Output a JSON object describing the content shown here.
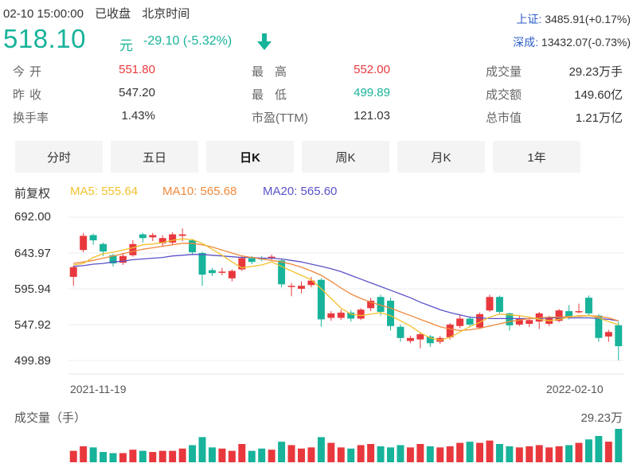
{
  "header": {
    "date_time": "02-10 15:00:00",
    "status": "已收盘",
    "timezone": "北京时间",
    "price": "518.10",
    "currency": "元",
    "change": "-29.10 (-5.32%)",
    "index_sh_label": "上证:",
    "index_sh_value": "3485.91(+0.17%)",
    "index_sz_label": "深成:",
    "index_sz_value": "13432.07(-0.73%)"
  },
  "quote": {
    "open_label": "今开",
    "open": "551.80",
    "prev_label": "昨收",
    "prev": "547.20",
    "turnover_rate_label": "换手率",
    "turnover_rate": "1.43%",
    "high_label": "最高",
    "high": "552.00",
    "low_label": "最低",
    "low": "499.89",
    "pe_label": "市盈(TTM)",
    "pe": "121.03",
    "volume_label": "成交量",
    "volume": "29.23万手",
    "amount_label": "成交额",
    "amount": "149.60亿",
    "mktcap_label": "总市值",
    "mktcap": "1.21万亿"
  },
  "tabs": [
    "分时",
    "五日",
    "日K",
    "周K",
    "月K",
    "1年"
  ],
  "active_tab": 2,
  "indicators": {
    "adjust": "前复权",
    "ma5": "MA5: 555.64",
    "ma10": "MA10: 565.68",
    "ma20": "MA20: 565.60"
  },
  "colors": {
    "up": "#e8383d",
    "down": "#17b39a",
    "ma5": "#f2c12e",
    "ma10": "#f08a3c",
    "ma20": "#5b52c7",
    "index_label": "#2b5cc8"
  },
  "chart_data": {
    "type": "candlestick",
    "y_ticks": [
      "692.00",
      "643.97",
      "595.94",
      "547.92",
      "499.89"
    ],
    "ylim": [
      499.89,
      692.0
    ],
    "x_labels": [
      "2021-11-19",
      "2022-02-10"
    ],
    "volume_label": "成交量（手）",
    "volume_max_label": "29.23万",
    "candles": [
      {
        "o": 612,
        "c": 625,
        "h": 627,
        "l": 600
      },
      {
        "o": 648,
        "c": 667,
        "h": 671,
        "l": 645
      },
      {
        "o": 668,
        "c": 661,
        "h": 670,
        "l": 655
      },
      {
        "o": 656,
        "c": 646,
        "h": 658,
        "l": 640
      },
      {
        "o": 641,
        "c": 630,
        "h": 643,
        "l": 626
      },
      {
        "o": 631,
        "c": 640,
        "h": 644,
        "l": 628
      },
      {
        "o": 641,
        "c": 656,
        "h": 661,
        "l": 639
      },
      {
        "o": 669,
        "c": 664,
        "h": 671,
        "l": 658
      },
      {
        "o": 665,
        "c": 668,
        "h": 671,
        "l": 660
      },
      {
        "o": 657,
        "c": 664,
        "h": 668,
        "l": 652
      },
      {
        "o": 658,
        "c": 669,
        "h": 672,
        "l": 655
      },
      {
        "o": 667,
        "c": 669,
        "h": 677,
        "l": 660
      },
      {
        "o": 661,
        "c": 645,
        "h": 663,
        "l": 641
      },
      {
        "o": 644,
        "c": 615,
        "h": 646,
        "l": 600
      },
      {
        "o": 621,
        "c": 617,
        "h": 624,
        "l": 613
      },
      {
        "o": 619,
        "c": 619,
        "h": 624,
        "l": 614
      },
      {
        "o": 610,
        "c": 620,
        "h": 622,
        "l": 606
      },
      {
        "o": 622,
        "c": 637,
        "h": 640,
        "l": 620
      },
      {
        "o": 637,
        "c": 632,
        "h": 640,
        "l": 629
      },
      {
        "o": 637,
        "c": 636,
        "h": 640,
        "l": 633
      },
      {
        "o": 638,
        "c": 639,
        "h": 642,
        "l": 635
      },
      {
        "o": 634,
        "c": 602,
        "h": 636,
        "l": 598
      },
      {
        "o": 599,
        "c": 600,
        "h": 604,
        "l": 586
      },
      {
        "o": 596,
        "c": 600,
        "h": 606,
        "l": 590
      },
      {
        "o": 601,
        "c": 607,
        "h": 612,
        "l": 598
      },
      {
        "o": 608,
        "c": 555,
        "h": 610,
        "l": 545
      },
      {
        "o": 557,
        "c": 563,
        "h": 566,
        "l": 553
      },
      {
        "o": 557,
        "c": 564,
        "h": 568,
        "l": 554
      },
      {
        "o": 564,
        "c": 556,
        "h": 567,
        "l": 552
      },
      {
        "o": 556,
        "c": 568,
        "h": 570,
        "l": 554
      },
      {
        "o": 570,
        "c": 580,
        "h": 584,
        "l": 566
      },
      {
        "o": 585,
        "c": 565,
        "h": 588,
        "l": 560
      },
      {
        "o": 580,
        "c": 546,
        "h": 584,
        "l": 540
      },
      {
        "o": 545,
        "c": 530,
        "h": 548,
        "l": 525
      },
      {
        "o": 526,
        "c": 530,
        "h": 533,
        "l": 523
      },
      {
        "o": 528,
        "c": 535,
        "h": 538,
        "l": 516
      },
      {
        "o": 532,
        "c": 523,
        "h": 534,
        "l": 518
      },
      {
        "o": 525,
        "c": 530,
        "h": 533,
        "l": 522
      },
      {
        "o": 531,
        "c": 548,
        "h": 550,
        "l": 528
      },
      {
        "o": 546,
        "c": 556,
        "h": 562,
        "l": 543
      },
      {
        "o": 556,
        "c": 548,
        "h": 559,
        "l": 545
      },
      {
        "o": 544,
        "c": 562,
        "h": 564,
        "l": 542
      },
      {
        "o": 567,
        "c": 585,
        "h": 588,
        "l": 565
      },
      {
        "o": 585,
        "c": 565,
        "h": 587,
        "l": 563
      },
      {
        "o": 563,
        "c": 547,
        "h": 564,
        "l": 540
      },
      {
        "o": 548,
        "c": 556,
        "h": 560,
        "l": 546
      },
      {
        "o": 549,
        "c": 554,
        "h": 557,
        "l": 545
      },
      {
        "o": 552,
        "c": 563,
        "h": 565,
        "l": 542
      },
      {
        "o": 549,
        "c": 557,
        "h": 560,
        "l": 546
      },
      {
        "o": 553,
        "c": 567,
        "h": 569,
        "l": 551
      },
      {
        "o": 566,
        "c": 559,
        "h": 574,
        "l": 555
      },
      {
        "o": 566,
        "c": 566,
        "h": 576,
        "l": 563
      },
      {
        "o": 584,
        "c": 563,
        "h": 587,
        "l": 560
      },
      {
        "o": 560,
        "c": 530,
        "h": 562,
        "l": 525
      },
      {
        "o": 532,
        "c": 538,
        "h": 541,
        "l": 525
      },
      {
        "o": 547,
        "c": 519,
        "h": 552,
        "l": 500
      }
    ],
    "ma5": [
      628,
      630,
      638,
      643,
      645,
      648,
      651,
      655,
      656,
      658,
      661,
      663,
      662,
      657,
      649,
      641,
      632,
      624,
      626,
      628,
      632,
      626,
      620,
      614,
      608,
      596,
      583,
      570,
      562,
      560,
      562,
      564,
      560,
      553,
      546,
      537,
      530,
      527,
      531,
      538,
      545,
      551,
      558,
      562,
      561,
      560,
      558,
      555,
      553,
      555,
      558,
      560,
      560,
      557,
      552,
      548
    ],
    "ma10": [
      630,
      632,
      634,
      637,
      640,
      643,
      646,
      649,
      651,
      653,
      655,
      657,
      657,
      655,
      652,
      648,
      644,
      640,
      638,
      636,
      634,
      632,
      629,
      625,
      620,
      614,
      606,
      597,
      589,
      583,
      578,
      574,
      570,
      565,
      560,
      555,
      550,
      545,
      542,
      540,
      541,
      543,
      546,
      549,
      552,
      554,
      556,
      557,
      558,
      558,
      559,
      559,
      560,
      559,
      557,
      553
    ],
    "ma20": [
      626,
      627,
      629,
      630,
      632,
      633,
      635,
      636,
      637,
      638,
      640,
      641,
      642,
      642,
      641,
      640,
      639,
      638,
      638,
      637,
      637,
      636,
      634,
      632,
      629,
      626,
      623,
      619,
      614,
      609,
      604,
      599,
      594,
      589,
      584,
      578,
      573,
      568,
      564,
      561,
      558,
      557,
      556,
      556,
      556,
      556,
      556,
      556,
      557,
      557,
      557,
      557,
      557,
      556,
      555,
      553
    ],
    "volumes": [
      10,
      14,
      13,
      9,
      8,
      8,
      11,
      10,
      9,
      10,
      10,
      12,
      15,
      22,
      13,
      12,
      10,
      16,
      10,
      12,
      11,
      18,
      15,
      12,
      13,
      22,
      17,
      13,
      12,
      15,
      16,
      14,
      13,
      15,
      13,
      16,
      14,
      13,
      14,
      17,
      18,
      17,
      19,
      16,
      14,
      13,
      14,
      15,
      13,
      14,
      15,
      17,
      20,
      23,
      18,
      29.23
    ],
    "volume_colors": [
      "up",
      "up",
      "down",
      "down",
      "down",
      "up",
      "up",
      "down",
      "up",
      "up",
      "up",
      "up",
      "down",
      "down",
      "down",
      "up",
      "up",
      "up",
      "down",
      "down",
      "up",
      "down",
      "up",
      "up",
      "up",
      "down",
      "up",
      "up",
      "down",
      "up",
      "up",
      "down",
      "down",
      "down",
      "up",
      "up",
      "down",
      "up",
      "up",
      "up",
      "down",
      "up",
      "up",
      "down",
      "down",
      "up",
      "up",
      "up",
      "up",
      "up",
      "down",
      "up",
      "down",
      "down",
      "up",
      "down"
    ]
  }
}
